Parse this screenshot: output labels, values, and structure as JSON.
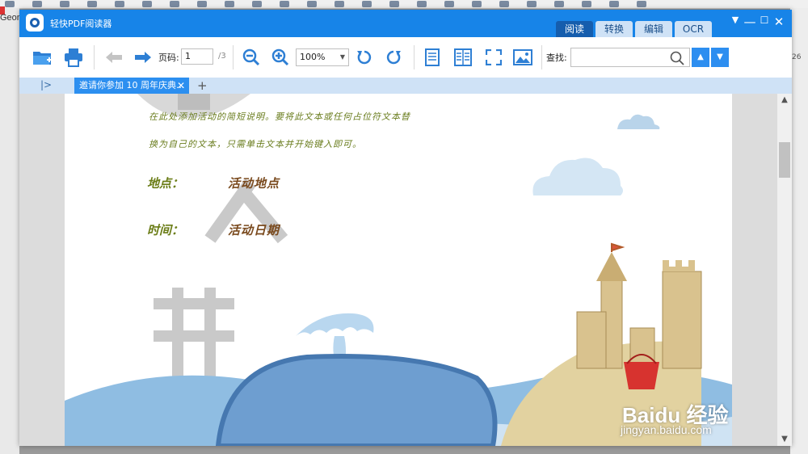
{
  "window": {
    "app_title": "轻快PDF阅读器",
    "tabs": [
      {
        "label": "阅读",
        "active": true
      },
      {
        "label": "转换",
        "active": false
      },
      {
        "label": "编辑",
        "active": false
      },
      {
        "label": "OCR",
        "active": false
      }
    ],
    "controls": {
      "menu": "▼",
      "minimize": "—",
      "maximize": "☐",
      "close": "✕"
    }
  },
  "background": {
    "left_text": "Geor",
    "right_number": "26"
  },
  "toolbar": {
    "page_label": "页码:",
    "page_value": "1",
    "page_total": "/3",
    "zoom_value": "100%",
    "find_label": "查找:",
    "find_placeholder": "",
    "accent": "#2d8ef0"
  },
  "doc_tab": {
    "sidebar_toggle": "|>",
    "title": "邀请你参加 10 周年庆典...",
    "close": "✕",
    "add": "+"
  },
  "document": {
    "desc_line1": "在此处添加活动的简短说明。要将此文本或任何占位符文本替",
    "desc_line2": "换为自己的文本，只需单击文本并开始键入即可。",
    "location_label": "地点：",
    "location_value": "活动地点",
    "time_label": "时间：",
    "time_value": "活动日期"
  },
  "watermark": {
    "brand": "Baidu 经验",
    "url": "jingyan.baidu.com"
  }
}
